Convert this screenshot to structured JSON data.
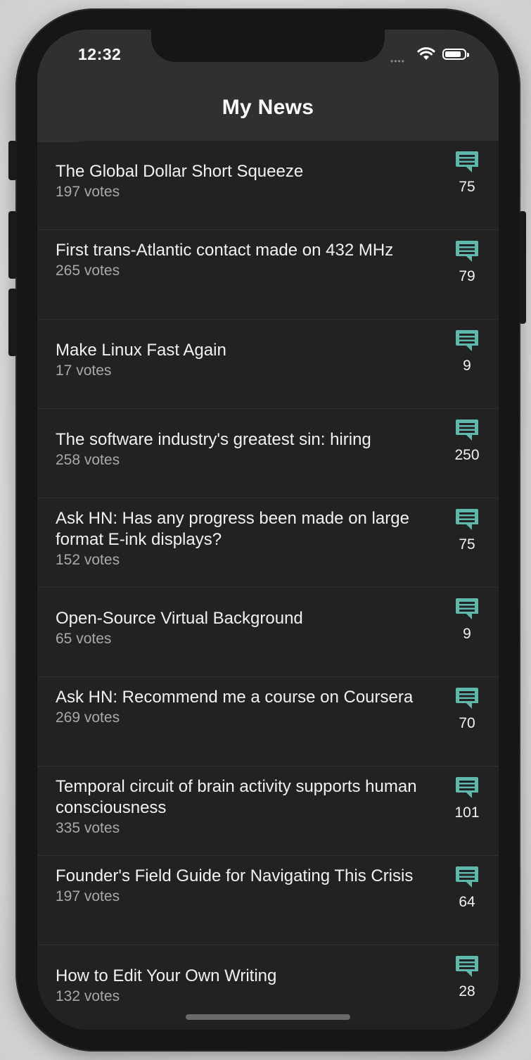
{
  "status_bar": {
    "time": "12:32",
    "signal": "••••"
  },
  "header": {
    "title": "My News"
  },
  "stories": [
    {
      "title": "The Global Dollar Short Squeeze",
      "votes": "197 votes",
      "comments": "75"
    },
    {
      "title": "First trans-Atlantic contact made on 432 MHz",
      "votes": "265 votes",
      "comments": "79"
    },
    {
      "title": "Make Linux Fast Again",
      "votes": "17 votes",
      "comments": "9"
    },
    {
      "title": "The software industry's greatest sin: hiring",
      "votes": "258 votes",
      "comments": "250"
    },
    {
      "title": "Ask HN: Has any progress been made on large format E-ink displays?",
      "votes": "152 votes",
      "comments": "75"
    },
    {
      "title": "Open-Source Virtual Background",
      "votes": "65 votes",
      "comments": "9"
    },
    {
      "title": "Ask HN: Recommend me a course on Coursera",
      "votes": "269 votes",
      "comments": "70"
    },
    {
      "title": "Temporal circuit of brain activity supports human consciousness",
      "votes": "335 votes",
      "comments": "101"
    },
    {
      "title": "Founder's Field Guide for Navigating This Crisis",
      "votes": "197 votes",
      "comments": "64"
    },
    {
      "title": "How to Edit Your Own Writing",
      "votes": "132 votes",
      "comments": "28"
    }
  ],
  "colors": {
    "accent": "#5fb8ac",
    "background": "#222222",
    "header": "#303030"
  },
  "icons": {
    "comment": "comment-icon",
    "wifi": "wifi-icon",
    "battery": "battery-icon"
  }
}
